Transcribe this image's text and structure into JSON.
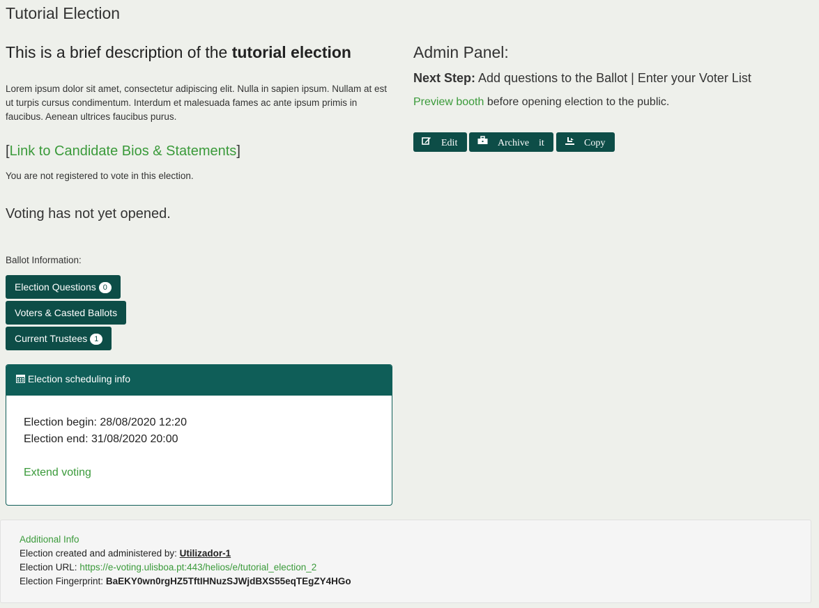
{
  "page": {
    "title": "Tutorial Election"
  },
  "description": {
    "heading_prefix": "This is a brief description of the",
    "heading_bold": "tutorial election",
    "body": "Lorem ipsum dolor sit amet, consectetur adipiscing elit. Nulla in sapien ipsum. Nullam at est ut turpis cursus condimentum. Interdum et malesuada fames ac ante ipsum primis in faucibus. Aenean ultrices faucibus purus."
  },
  "bios_link": {
    "open": "[",
    "label": "Link to Candidate Bios & Statements",
    "close": "]"
  },
  "registration_status": "You are not registered to vote in this election.",
  "voting_status": "Voting has not yet opened.",
  "ballot": {
    "label": "Ballot Information:",
    "buttons": [
      {
        "label": "Election Questions",
        "badge": "0"
      },
      {
        "label": "Voters & Casted Ballots"
      },
      {
        "label": "Current Trustees",
        "badge": "1"
      }
    ]
  },
  "scheduling": {
    "title": "Election scheduling info",
    "icon": "calendar-icon",
    "begin": "Election begin: 28/08/2020 12:20",
    "end": "Election end: 31/08/2020 20:00",
    "extend_link": "Extend voting"
  },
  "admin": {
    "title": "Admin Panel:",
    "next_step_label": "Next Step:",
    "next_step_text": "Add questions to the Ballot | Enter your Voter List",
    "preview_link": "Preview booth",
    "preview_suffix": "before opening election to the public.",
    "buttons": [
      {
        "label": "Edit",
        "icon": "edit-icon"
      },
      {
        "label": "Archive",
        "extra": "it",
        "icon": "briefcase-icon"
      },
      {
        "label": "Copy",
        "icon": "copy-icon"
      }
    ]
  },
  "footer": {
    "title": "Additional Info",
    "created_label": "Election created and administered by:",
    "created_user": "Utilizador-1",
    "url_label": "Election URL:",
    "url": "https://e-voting.ulisboa.pt:443/helios/e/tutorial_election_2",
    "fingerprint_label": "Election Fingerprint:",
    "fingerprint": "BaEKY0wn0rgHZ5TftIHNuzSJWjdBXS55eqTEgZY4HGo"
  },
  "colors": {
    "primary": "#0d4d47",
    "panel_header": "#0f5e58",
    "link": "#3a9a3a",
    "background": "#eef0eb"
  }
}
